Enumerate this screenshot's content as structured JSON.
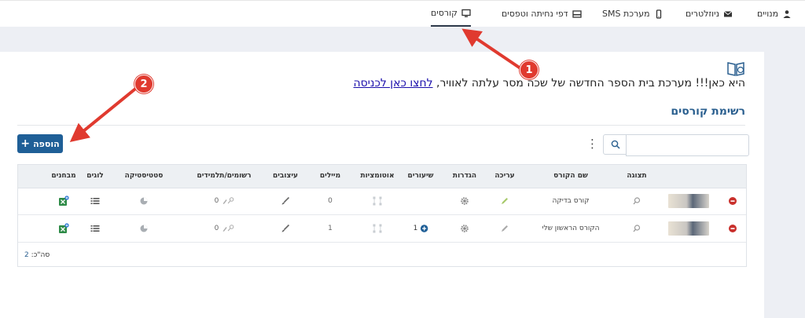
{
  "topnav": {
    "items": [
      {
        "label": "מנויים",
        "icon": "users-cog-icon"
      },
      {
        "label": "ניוזלטרים",
        "icon": "envelope-icon"
      },
      {
        "label": "מערכת SMS",
        "icon": "mobile-icon"
      },
      {
        "label": "דפי נחיתה וטפסים",
        "icon": "form-icon"
      },
      {
        "label": "קורסים",
        "icon": "monitor-icon",
        "active": true
      }
    ]
  },
  "announcement": {
    "text": "היא כאן!!! מערכת בית הספר החדשה של שכה מסר עלתה לאוויר,",
    "link": "לחצו כאן לכניסה"
  },
  "section_title": "רשימת קורסים",
  "add_button": {
    "label": "הוספה",
    "icon": "plus-icon"
  },
  "search": {
    "placeholder": "",
    "value": ""
  },
  "table": {
    "columns": [
      "תצוגה",
      "שם הקורס",
      "עריכה",
      "הגדרות",
      "שיעורים",
      "אוטומציות",
      "מיילים",
      "עיצובים",
      "רשומים/תלמידים",
      "סטטיסטיקה",
      "לוגים",
      "מבחנים"
    ],
    "rows": [
      {
        "name": "קורס בדיקה",
        "lessons": "",
        "emails": "0",
        "registered": "0"
      },
      {
        "name": "הקורס הראשון שלי",
        "lessons": "1",
        "emails": "1",
        "registered": "0"
      }
    ],
    "total_label": "סה\"כ:",
    "total_value": "2"
  },
  "annotations": {
    "arrow1": "1",
    "arrow2": "2"
  },
  "colors": {
    "primary": "#1f5f97",
    "title": "#2a5f8f",
    "arrow": "#e03a2f",
    "active_underline": "#2e3a4a"
  }
}
